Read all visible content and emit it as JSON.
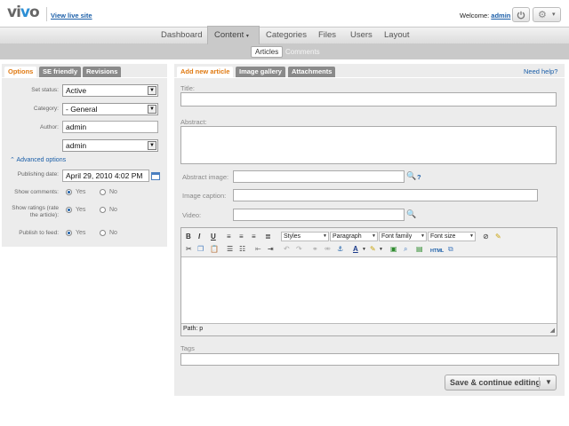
{
  "header": {
    "logo": "vivo",
    "view_live": "View live site",
    "welcome_prefix": "Welcome: ",
    "username": "admin"
  },
  "nav": {
    "items": [
      "Dashboard",
      "Content",
      "Categories",
      "Files",
      "Users",
      "Layout"
    ],
    "active": "Content"
  },
  "subnav": {
    "articles": "Articles",
    "comments": "Comments"
  },
  "left": {
    "tabs": [
      "Options",
      "SE friendly",
      "Revisions"
    ],
    "status_label": "Set status:",
    "status_value": "Active",
    "category_label": "Category:",
    "category_value": "- General",
    "author_label": "Author:",
    "author_value": "admin",
    "author_select": "admin",
    "advanced": "Advanced options",
    "pub_date_label": "Publishing date:",
    "pub_date_value": "April 29, 2010 4:02 PM",
    "show_comments_label": "Show comments:",
    "show_ratings_label": "Show ratings (rate the article):",
    "publish_feed_label": "Publish to feed:",
    "yes": "Yes",
    "no": "No"
  },
  "right": {
    "tabs": [
      "Add new article",
      "Image gallery",
      "Attachments"
    ],
    "need_help": "Need help?",
    "title_label": "Title:",
    "abstract_label": "Abstract:",
    "abstract_image_label": "Abstract image:",
    "image_caption_label": "Image caption:",
    "video_label": "Video:",
    "question": "?",
    "editor": {
      "styles": "Styles",
      "paragraph": "Paragraph",
      "font_family": "Font family",
      "font_size": "Font size",
      "path": "Path: p",
      "html": "HTML"
    },
    "tags_label": "Tags",
    "save_label": "Save & continue editing"
  }
}
